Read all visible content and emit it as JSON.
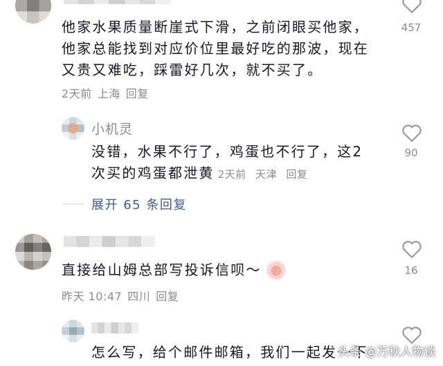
{
  "comments": [
    {
      "text_lines": [
        "他家水果质量断崖式下滑，之前闭眼买他家，",
        "他家总能找到对应价位里最好吃的那波，现在",
        "又贵又难吃，踩雷好几次，就不买了。"
      ],
      "time": "2天前",
      "location": "上海",
      "reply_label": "回复",
      "likes": "457",
      "reply": {
        "username": "小机灵",
        "text_line1": "没错，水果不行了，鸡蛋也不行了，这2",
        "text_line2": "次买的鸡蛋都泄黄",
        "time": "2天前",
        "location": "天津",
        "reply_label": "回复",
        "likes": "90"
      },
      "expand_label": "展开 65 条回复"
    },
    {
      "text": "直接给山姆总部写投诉信呗～",
      "time": "昨天 10:47",
      "location": "四川",
      "reply_label": "回复",
      "likes": "16"
    },
    {
      "text": "怎么写，给个邮件邮箱，我们一起发一下"
    }
  ],
  "watermark": "头条 @万秋人物谈",
  "icons": {
    "like": "heart-outline-icon",
    "sticker": "emoji-sticker-icon"
  },
  "colors": {
    "text": "#161823",
    "meta": "#8a8b91",
    "link": "#3b5d8f"
  }
}
